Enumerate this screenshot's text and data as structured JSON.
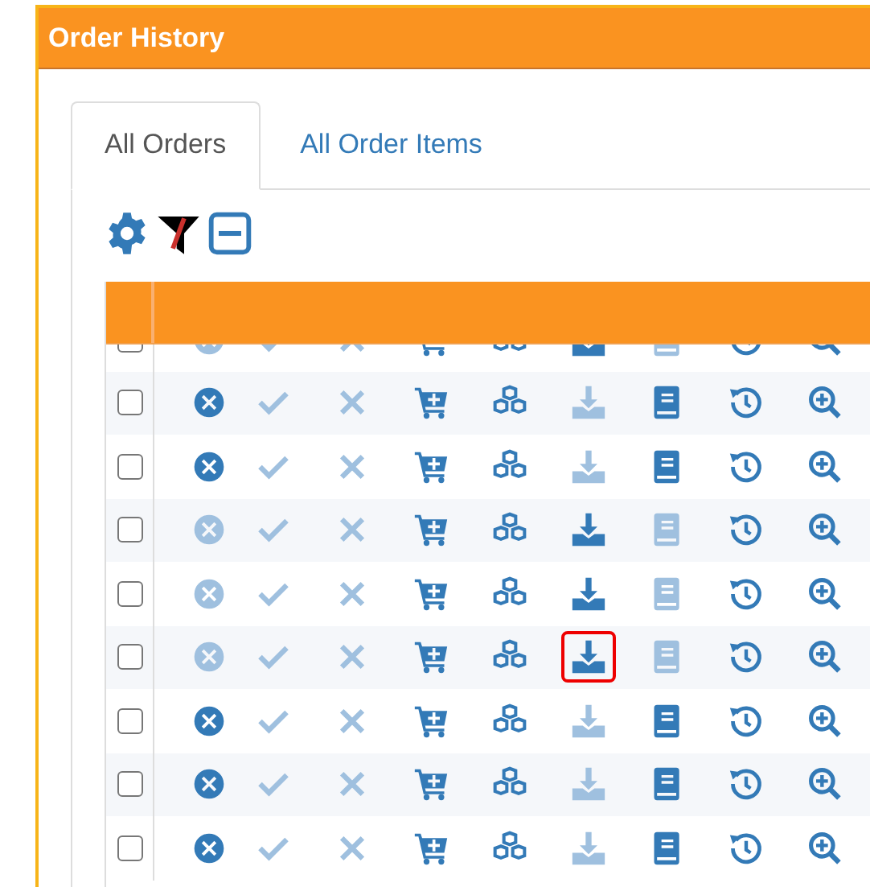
{
  "panel": {
    "title": "Order History"
  },
  "tabs": [
    {
      "label": "All Orders",
      "selected": true
    },
    {
      "label": "All Order Items",
      "selected": false
    }
  ],
  "rows": [
    {
      "checked": false,
      "cancel_enabled": false,
      "approve_enabled": false,
      "reject_enabled": false,
      "download_enabled": true,
      "invoice_enabled": false,
      "highlighted": false
    },
    {
      "checked": false,
      "cancel_enabled": true,
      "approve_enabled": false,
      "reject_enabled": false,
      "download_enabled": false,
      "invoice_enabled": true,
      "highlighted": false
    },
    {
      "checked": false,
      "cancel_enabled": true,
      "approve_enabled": false,
      "reject_enabled": false,
      "download_enabled": false,
      "invoice_enabled": true,
      "highlighted": false
    },
    {
      "checked": false,
      "cancel_enabled": false,
      "approve_enabled": false,
      "reject_enabled": false,
      "download_enabled": true,
      "invoice_enabled": false,
      "highlighted": false
    },
    {
      "checked": false,
      "cancel_enabled": false,
      "approve_enabled": false,
      "reject_enabled": false,
      "download_enabled": true,
      "invoice_enabled": false,
      "highlighted": false
    },
    {
      "checked": false,
      "cancel_enabled": false,
      "approve_enabled": false,
      "reject_enabled": false,
      "download_enabled": true,
      "invoice_enabled": false,
      "highlighted": true
    },
    {
      "checked": false,
      "cancel_enabled": true,
      "approve_enabled": false,
      "reject_enabled": false,
      "download_enabled": false,
      "invoice_enabled": true,
      "highlighted": false
    },
    {
      "checked": false,
      "cancel_enabled": true,
      "approve_enabled": false,
      "reject_enabled": false,
      "download_enabled": false,
      "invoice_enabled": true,
      "highlighted": false
    },
    {
      "checked": false,
      "cancel_enabled": true,
      "approve_enabled": false,
      "reject_enabled": false,
      "download_enabled": false,
      "invoice_enabled": true,
      "highlighted": false
    }
  ]
}
